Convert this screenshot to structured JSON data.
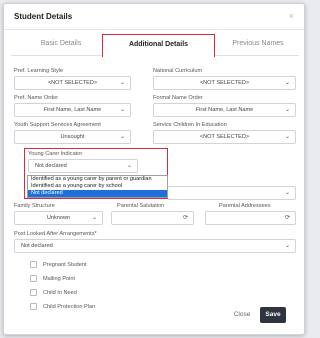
{
  "dialog": {
    "title": "Student Details",
    "close_glyph": "×"
  },
  "tabs": [
    {
      "label": "Basic Details"
    },
    {
      "label": "Additional Details"
    },
    {
      "label": "Previous Names"
    }
  ],
  "fields": {
    "learning_style": {
      "label": "Pref. Learning Style",
      "value": "<NOT SELECTED>"
    },
    "national_curriculum": {
      "label": "National Curriculum",
      "value": "<NOT SELECTED>"
    },
    "name_order": {
      "label": "Pref. Name Order",
      "value": "First Name, Last Name"
    },
    "formal_name_order": {
      "label": "Formal Name Order",
      "value": "First Name, Last Name"
    },
    "youth_support": {
      "label": "Youth Support Services Agreement",
      "value": "Unsought"
    },
    "service_children": {
      "label": "Service Children In Education",
      "value": "<NOT SELECTED>"
    },
    "young_carer": {
      "label": "Young Carer Indicator",
      "value": "Not declared",
      "options": [
        "Identified as a young carer by parent or guardian",
        "Identified as a young carer by school",
        "Not declared"
      ],
      "selected_index": 2
    },
    "family_structure": {
      "label": "Family Structure",
      "value": "Unknown"
    },
    "parental_salutation": {
      "label": "Parental Salutation"
    },
    "parental_addressees": {
      "label": "Parental Addressees"
    },
    "looked_after": {
      "label": "Post Looked After Arrangements*",
      "value": "Not declared"
    }
  },
  "checkboxes": [
    {
      "label": "Pregnant Student",
      "checked": false
    },
    {
      "label": "Mailing Point",
      "checked": false
    },
    {
      "label": "Child In Need",
      "checked": false
    },
    {
      "label": "Child Protection Plan",
      "checked": false
    }
  ],
  "buttons": {
    "close": "Close",
    "save": "Save"
  },
  "icons": {
    "chevron": "chevron-down-icon",
    "refresh": "refresh-icon"
  },
  "colors": {
    "highlight": "#d12f3c",
    "selected_option": "#1e6fd9",
    "save_bg": "#2f3540"
  }
}
